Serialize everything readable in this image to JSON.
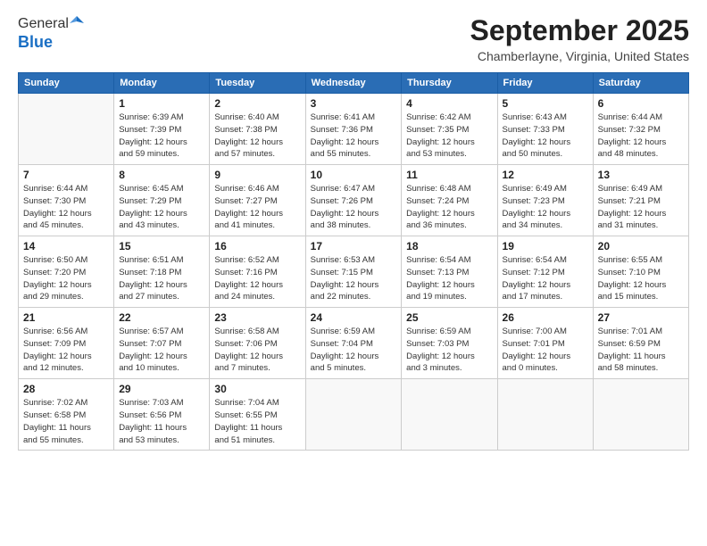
{
  "header": {
    "logo_general": "General",
    "logo_blue": "Blue",
    "month": "September 2025",
    "location": "Chamberlayne, Virginia, United States"
  },
  "days_of_week": [
    "Sunday",
    "Monday",
    "Tuesday",
    "Wednesday",
    "Thursday",
    "Friday",
    "Saturday"
  ],
  "weeks": [
    [
      {
        "num": "",
        "info": ""
      },
      {
        "num": "1",
        "info": "Sunrise: 6:39 AM\nSunset: 7:39 PM\nDaylight: 12 hours\nand 59 minutes."
      },
      {
        "num": "2",
        "info": "Sunrise: 6:40 AM\nSunset: 7:38 PM\nDaylight: 12 hours\nand 57 minutes."
      },
      {
        "num": "3",
        "info": "Sunrise: 6:41 AM\nSunset: 7:36 PM\nDaylight: 12 hours\nand 55 minutes."
      },
      {
        "num": "4",
        "info": "Sunrise: 6:42 AM\nSunset: 7:35 PM\nDaylight: 12 hours\nand 53 minutes."
      },
      {
        "num": "5",
        "info": "Sunrise: 6:43 AM\nSunset: 7:33 PM\nDaylight: 12 hours\nand 50 minutes."
      },
      {
        "num": "6",
        "info": "Sunrise: 6:44 AM\nSunset: 7:32 PM\nDaylight: 12 hours\nand 48 minutes."
      }
    ],
    [
      {
        "num": "7",
        "info": "Sunrise: 6:44 AM\nSunset: 7:30 PM\nDaylight: 12 hours\nand 45 minutes."
      },
      {
        "num": "8",
        "info": "Sunrise: 6:45 AM\nSunset: 7:29 PM\nDaylight: 12 hours\nand 43 minutes."
      },
      {
        "num": "9",
        "info": "Sunrise: 6:46 AM\nSunset: 7:27 PM\nDaylight: 12 hours\nand 41 minutes."
      },
      {
        "num": "10",
        "info": "Sunrise: 6:47 AM\nSunset: 7:26 PM\nDaylight: 12 hours\nand 38 minutes."
      },
      {
        "num": "11",
        "info": "Sunrise: 6:48 AM\nSunset: 7:24 PM\nDaylight: 12 hours\nand 36 minutes."
      },
      {
        "num": "12",
        "info": "Sunrise: 6:49 AM\nSunset: 7:23 PM\nDaylight: 12 hours\nand 34 minutes."
      },
      {
        "num": "13",
        "info": "Sunrise: 6:49 AM\nSunset: 7:21 PM\nDaylight: 12 hours\nand 31 minutes."
      }
    ],
    [
      {
        "num": "14",
        "info": "Sunrise: 6:50 AM\nSunset: 7:20 PM\nDaylight: 12 hours\nand 29 minutes."
      },
      {
        "num": "15",
        "info": "Sunrise: 6:51 AM\nSunset: 7:18 PM\nDaylight: 12 hours\nand 27 minutes."
      },
      {
        "num": "16",
        "info": "Sunrise: 6:52 AM\nSunset: 7:16 PM\nDaylight: 12 hours\nand 24 minutes."
      },
      {
        "num": "17",
        "info": "Sunrise: 6:53 AM\nSunset: 7:15 PM\nDaylight: 12 hours\nand 22 minutes."
      },
      {
        "num": "18",
        "info": "Sunrise: 6:54 AM\nSunset: 7:13 PM\nDaylight: 12 hours\nand 19 minutes."
      },
      {
        "num": "19",
        "info": "Sunrise: 6:54 AM\nSunset: 7:12 PM\nDaylight: 12 hours\nand 17 minutes."
      },
      {
        "num": "20",
        "info": "Sunrise: 6:55 AM\nSunset: 7:10 PM\nDaylight: 12 hours\nand 15 minutes."
      }
    ],
    [
      {
        "num": "21",
        "info": "Sunrise: 6:56 AM\nSunset: 7:09 PM\nDaylight: 12 hours\nand 12 minutes."
      },
      {
        "num": "22",
        "info": "Sunrise: 6:57 AM\nSunset: 7:07 PM\nDaylight: 12 hours\nand 10 minutes."
      },
      {
        "num": "23",
        "info": "Sunrise: 6:58 AM\nSunset: 7:06 PM\nDaylight: 12 hours\nand 7 minutes."
      },
      {
        "num": "24",
        "info": "Sunrise: 6:59 AM\nSunset: 7:04 PM\nDaylight: 12 hours\nand 5 minutes."
      },
      {
        "num": "25",
        "info": "Sunrise: 6:59 AM\nSunset: 7:03 PM\nDaylight: 12 hours\nand 3 minutes."
      },
      {
        "num": "26",
        "info": "Sunrise: 7:00 AM\nSunset: 7:01 PM\nDaylight: 12 hours\nand 0 minutes."
      },
      {
        "num": "27",
        "info": "Sunrise: 7:01 AM\nSunset: 6:59 PM\nDaylight: 11 hours\nand 58 minutes."
      }
    ],
    [
      {
        "num": "28",
        "info": "Sunrise: 7:02 AM\nSunset: 6:58 PM\nDaylight: 11 hours\nand 55 minutes."
      },
      {
        "num": "29",
        "info": "Sunrise: 7:03 AM\nSunset: 6:56 PM\nDaylight: 11 hours\nand 53 minutes."
      },
      {
        "num": "30",
        "info": "Sunrise: 7:04 AM\nSunset: 6:55 PM\nDaylight: 11 hours\nand 51 minutes."
      },
      {
        "num": "",
        "info": ""
      },
      {
        "num": "",
        "info": ""
      },
      {
        "num": "",
        "info": ""
      },
      {
        "num": "",
        "info": ""
      }
    ]
  ]
}
